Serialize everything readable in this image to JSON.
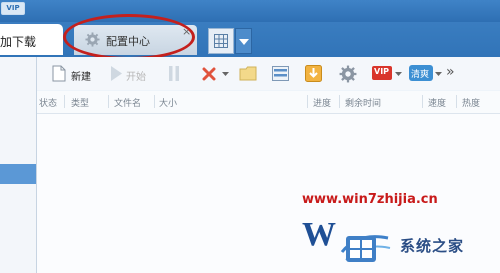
{
  "topbar": {
    "vip_badge": "VIP"
  },
  "tabs": {
    "download_label": "加下载",
    "config_label": "配置中心",
    "close_glyph": "×"
  },
  "toolbar": {
    "new_label": "新建",
    "start_label": "开始",
    "more_glyph": "»",
    "vip_label": "VIP",
    "clear_label": "清爽"
  },
  "columns": {
    "status": "状态",
    "type": "类型",
    "filename": "文件名",
    "size": "大小",
    "progress": "进度",
    "remaining": "剩余时间",
    "speed": "速度",
    "heat": "热度"
  },
  "watermark": {
    "url": "www.win7zhijia.cn",
    "brand": "系统之家"
  },
  "colors": {
    "accent_blue": "#3174b8",
    "highlight_red": "#c4201d",
    "sidebar_selected": "#5b98d6"
  }
}
